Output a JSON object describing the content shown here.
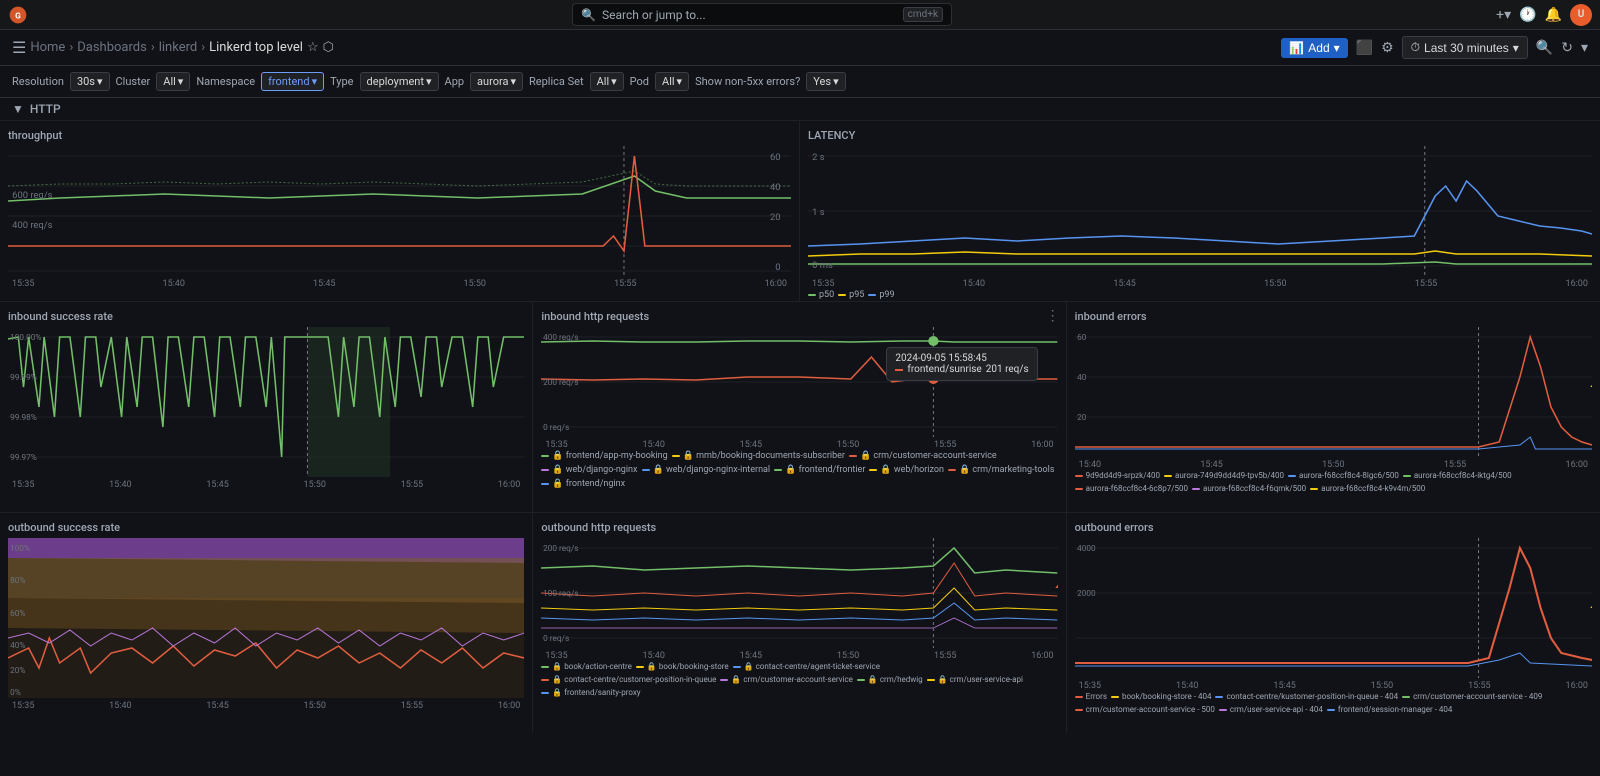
{
  "topbar": {
    "search_placeholder": "Search or jump to...",
    "shortcut": "cmd+k",
    "plus_label": "+▾",
    "avatar_initials": "U"
  },
  "navbar": {
    "home": "Home",
    "dashboards": "Dashboards",
    "linkerd": "linkerd",
    "page": "Linkerd top level",
    "add_label": "Add",
    "time_label": "Last 30 minutes",
    "settings_icon": "⚙",
    "calendar_icon": "📅"
  },
  "filters": {
    "resolution_label": "Resolution",
    "resolution_value": "30s",
    "cluster_label": "Cluster",
    "cluster_value": "All",
    "namespace_label": "Namespace",
    "namespace_value": "frontend",
    "type_label": "Type",
    "type_value": "deployment",
    "app_label": "App",
    "app_value": "aurora",
    "replica_set_label": "Replica Set",
    "replica_set_value": "All",
    "pod_label": "Pod",
    "pod_value": "All",
    "non5xx_label": "Show non-5xx errors?",
    "non5xx_value": "Yes"
  },
  "section_http": "HTTP",
  "panels": {
    "throughput": {
      "title": "throughput",
      "y_labels": [
        "60",
        "40",
        "20",
        "0"
      ],
      "y_labels_left": [
        "600 req/s",
        "400 req/s"
      ],
      "x_labels": [
        "15:35",
        "15:40",
        "15:45",
        "15:50",
        "15:55",
        "16:00"
      ]
    },
    "latency": {
      "title": "LATENCY",
      "y_labels": [
        "2 s",
        "1 s",
        "0 ms"
      ],
      "x_labels": [
        "15:35",
        "15:40",
        "15:45",
        "15:50",
        "15:55",
        "16:00"
      ],
      "legend": [
        {
          "label": "p50",
          "color": "#73bf69"
        },
        {
          "label": "p95",
          "color": "#f2cc0c"
        },
        {
          "label": "p99",
          "color": "#5794f2"
        }
      ]
    },
    "inbound_success": {
      "title": "Inbound Success Rate",
      "y_labels": [
        "100.00%",
        "99.99%",
        "99.98%",
        "99.97%"
      ],
      "x_labels": [
        "15:35",
        "15:40",
        "15:45",
        "15:50",
        "15:55",
        "16:00"
      ]
    },
    "inbound_http": {
      "title": "Inbound HTTP Requests",
      "y_labels": [
        "400 req/s",
        "200 req/s",
        "0 req/s"
      ],
      "x_labels": [
        "15:35",
        "15:40",
        "15:45",
        "15:50",
        "15:55",
        "16:00"
      ],
      "tooltip": {
        "time": "2024-09-05 15:58:45",
        "label": "frontend/sunrise",
        "value": "201 req/s"
      },
      "legend": [
        {
          "label": "frontend/app-my-booking",
          "color": "#73bf69"
        },
        {
          "label": "mmb/booking-documents-subscriber",
          "color": "#f2cc0c"
        },
        {
          "label": "crm/customer-account-service",
          "color": "#e05e3f"
        },
        {
          "label": "web/django-nginx",
          "color": "#b877d9"
        },
        {
          "label": "web/django-nginx-internal",
          "color": "#5794f2"
        },
        {
          "label": "frontend/frontier",
          "color": "#73bf69"
        },
        {
          "label": "web/horizon",
          "color": "#f2cc0c"
        },
        {
          "label": "crm/marketing-tools",
          "color": "#e05e3f"
        },
        {
          "label": "frontend/nginx",
          "color": "#5794f2"
        }
      ]
    },
    "inbound_errors": {
      "title": "Inbound errors",
      "y_labels": [
        "60",
        "40",
        "20"
      ],
      "x_labels": [
        "15:40",
        "15:45",
        "15:50",
        "15:55",
        "16:00"
      ],
      "legend": [
        {
          "label": "9d9dd4d9-srpzk/400",
          "color": "#e05e3f"
        },
        {
          "label": "aurora-749d9dd4d9-tpv5b/400",
          "color": "#f2cc0c"
        },
        {
          "label": "aurora-f68ccf8c4-8lgc6/500",
          "color": "#5794f2"
        },
        {
          "label": "aurora-f68ccf8c4-iktg4/500",
          "color": "#73bf69"
        },
        {
          "label": "aurora-f68ccf8c4-6c8p7/500",
          "color": "#e05e3f"
        },
        {
          "label": "aurora-f68ccf8c4-f6qmk/500",
          "color": "#b877d9"
        },
        {
          "label": "aurora-f68ccf8c4-k9v4m/500",
          "color": "#f2cc0c"
        }
      ]
    },
    "outbound_success": {
      "title": "Outbound Success Rate",
      "y_labels": [
        "100%",
        "80%",
        "60%",
        "40%",
        "20%",
        "0%"
      ],
      "x_labels": [
        "15:35",
        "15:40",
        "15:45",
        "15:50",
        "15:55",
        "16:00"
      ]
    },
    "outbound_http": {
      "title": "Outbound HTTP Requests",
      "y_labels": [
        "200 req/s",
        "100 req/s",
        "0 req/s"
      ],
      "x_labels": [
        "15:35",
        "15:40",
        "15:45",
        "15:50",
        "15:55",
        "16:00"
      ],
      "legend": [
        {
          "label": "book/action-centre",
          "color": "#73bf69"
        },
        {
          "label": "book/booking-store",
          "color": "#f2cc0c"
        },
        {
          "label": "contact-centre/agent-ticket-service",
          "color": "#5794f2"
        },
        {
          "label": "contact-centre/customer-position-in-queue",
          "color": "#e05e3f"
        },
        {
          "label": "crm/customer-account-service",
          "color": "#b877d9"
        },
        {
          "label": "crm/hedwig",
          "color": "#73bf69"
        },
        {
          "label": "crm/user-service-api",
          "color": "#f2cc0c"
        },
        {
          "label": "frontend/sanity-proxy",
          "color": "#5794f2"
        }
      ]
    },
    "outbound_errors": {
      "title": "Outbound errors",
      "y_labels": [
        "4000",
        "2000"
      ],
      "x_labels": [
        "15:35",
        "15:40",
        "15:45",
        "15:50",
        "15:55",
        "16:00"
      ],
      "legend": [
        {
          "label": "Errors",
          "color": "#e05e3f"
        },
        {
          "label": "book/booking-store - 404",
          "color": "#f2cc0c"
        },
        {
          "label": "contact-centre/kustomer-position-in-queue - 404",
          "color": "#5794f2"
        },
        {
          "label": "crm/customer-account-service - 409",
          "color": "#73bf69"
        },
        {
          "label": "crm/customer-account-service - 500",
          "color": "#e05e3f"
        },
        {
          "label": "crm/user-service-api - 404",
          "color": "#b877d9"
        },
        {
          "label": "frontend/session-manager - 404",
          "color": "#f2cc0c"
        }
      ]
    }
  }
}
